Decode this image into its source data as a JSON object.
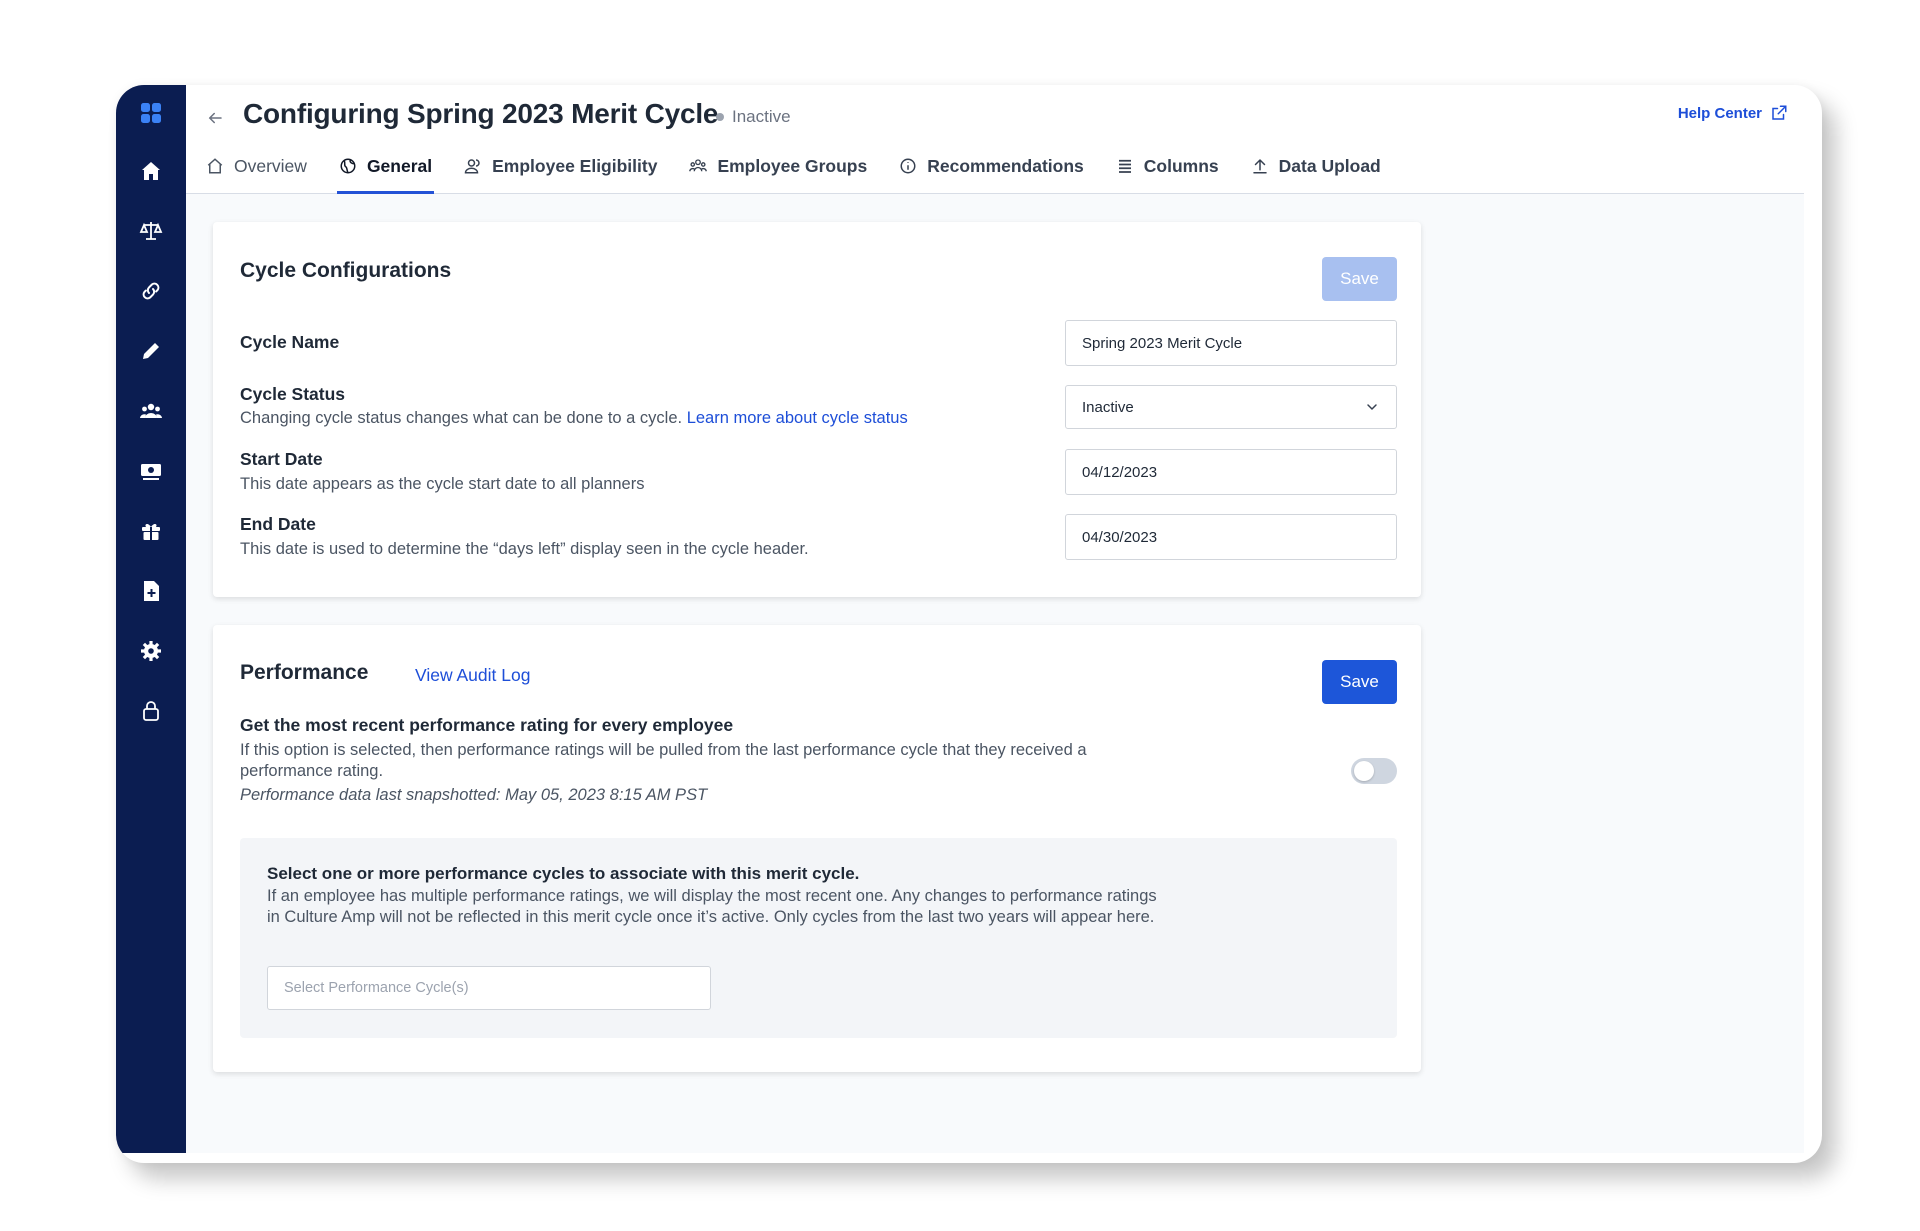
{
  "sidebar": {
    "items": [
      {
        "icon": "grid-logo-icon"
      },
      {
        "icon": "home-icon"
      },
      {
        "icon": "scales-icon"
      },
      {
        "icon": "link-icon"
      },
      {
        "icon": "pencil-icon"
      },
      {
        "icon": "team-icon"
      },
      {
        "icon": "cash-icon"
      },
      {
        "icon": "gift-icon"
      },
      {
        "icon": "add-document-icon"
      },
      {
        "icon": "gear-icon"
      },
      {
        "icon": "lock-icon"
      }
    ]
  },
  "header": {
    "title": "Configuring Spring 2023 Merit Cycle",
    "status": "Inactive",
    "help_label": "Help Center"
  },
  "tabs": [
    {
      "label": "Overview",
      "icon": "home-outline-icon"
    },
    {
      "label": "General",
      "icon": "globe-icon",
      "active": true
    },
    {
      "label": "Employee Eligibility",
      "icon": "users-icon"
    },
    {
      "label": "Employee Groups",
      "icon": "groups-icon"
    },
    {
      "label": "Recommendations",
      "icon": "info-icon"
    },
    {
      "label": "Columns",
      "icon": "list-icon"
    },
    {
      "label": "Data Upload",
      "icon": "upload-icon"
    }
  ],
  "cycle_config": {
    "title": "Cycle Configurations",
    "save_label": "Save",
    "cycle_name": {
      "label": "Cycle Name",
      "value": "Spring 2023 Merit Cycle"
    },
    "cycle_status": {
      "label": "Cycle Status",
      "description": "Changing cycle status changes what can be done to a cycle.",
      "link": "Learn more about cycle status",
      "value": "Inactive"
    },
    "start_date": {
      "label": "Start Date",
      "description": "This date appears as the cycle start date to all planners",
      "value": "04/12/2023"
    },
    "end_date": {
      "label": "End Date",
      "description": "This date is used to determine the “days left” display seen in the cycle header.",
      "value": "04/30/2023"
    }
  },
  "performance": {
    "title": "Performance",
    "audit_link": "View Audit Log",
    "save_label": "Save",
    "option_label": "Get the most recent performance rating for every employee",
    "option_description": "If this option is selected, then performance ratings will be pulled from the last performance cycle that they received a performance rating.",
    "snapshot_text": "Performance data last snapshotted: May 05, 2023 8:15 AM PST",
    "toggle_on": false,
    "select_title": "Select one or more performance cycles to associate with this merit cycle.",
    "select_description": "If an employee has multiple performance ratings, we will display the most recent one. Any changes to performance ratings in Culture Amp will not be reflected in this merit cycle once it’s active. Only cycles from the last two years will appear here.",
    "select_placeholder": "Select Performance Cycle(s)"
  },
  "colors": {
    "sidebar": "#0b1d51",
    "primary": "#1d56d9",
    "link": "#1d4ed8"
  }
}
